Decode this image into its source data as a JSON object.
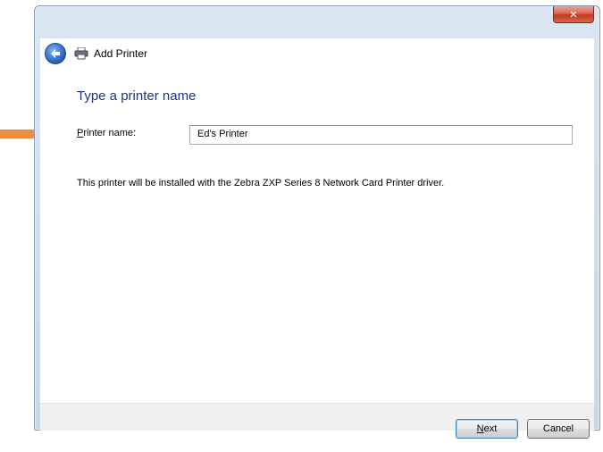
{
  "window": {
    "title": "Add Printer",
    "close_symbol": "✕"
  },
  "page": {
    "heading": "Type a printer name",
    "printer_name_label_first": "P",
    "printer_name_label_rest": "rinter name:",
    "printer_name_value": "Ed's Printer",
    "info_text": "This printer will be installed with the Zebra ZXP Series 8 Network Card Printer driver."
  },
  "buttons": {
    "next_first": "N",
    "next_rest": "ext",
    "cancel": "Cancel"
  },
  "colors": {
    "heading": "#1e3287",
    "arrow": "#f08a3c",
    "close_button": "#c8412a"
  },
  "icons": {
    "back": "back-arrow-icon",
    "printer": "printer-icon",
    "close": "close-icon",
    "callout": "callout-arrow-icon"
  }
}
